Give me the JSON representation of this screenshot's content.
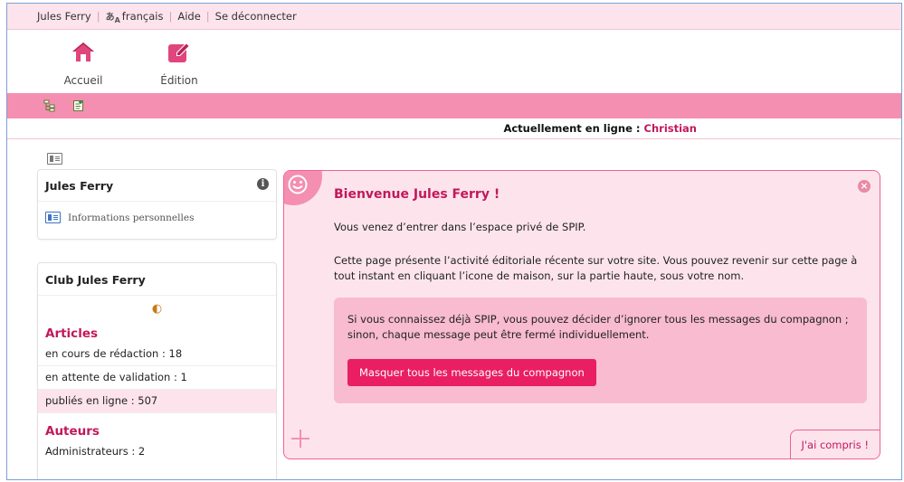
{
  "topbar": {
    "user": "Jules Ferry",
    "language": "français",
    "help": "Aide",
    "logout": "Se déconnecter"
  },
  "nav": {
    "home_label": "Accueil",
    "edit_label": "Édition"
  },
  "online": {
    "label": "Actuellement en ligne :",
    "name": "Christian"
  },
  "identity_box": {
    "title": "Jules Ferry",
    "link": "Informations personnelles"
  },
  "club_box": {
    "title": "Club Jules Ferry",
    "articles_heading": "Articles",
    "articles": [
      "en cours de rédaction : 18",
      "en attente de validation : 1",
      "publiés en ligne : 507"
    ],
    "authors_heading": "Auteurs",
    "authors": [
      "Administrateurs : 2"
    ]
  },
  "companion": {
    "title": "Bienvenue Jules Ferry !",
    "p1": "Vous venez d’entrer dans l’espace privé de SPIP.",
    "p2": "Cette page présente l’activité éditoriale récente sur votre site. Vous pouvez revenir sur cette page à tout instant en cliquant l’icone de maison, sur la partie haute, sous votre nom.",
    "inner_text": "Si vous connaissez déjà SPIP, vous pouvez décider d’ignorer tous les messages du compagnon ; sinon, chaque message peut être fermé individuellement.",
    "hide_button": "Masquer tous les messages du compagnon",
    "ok_button": "J'ai compris !"
  },
  "colors": {
    "accent": "#c2185b",
    "pink_bar": "#f48fb1",
    "pale_pink": "#fde4ec",
    "button": "#e91e63"
  }
}
